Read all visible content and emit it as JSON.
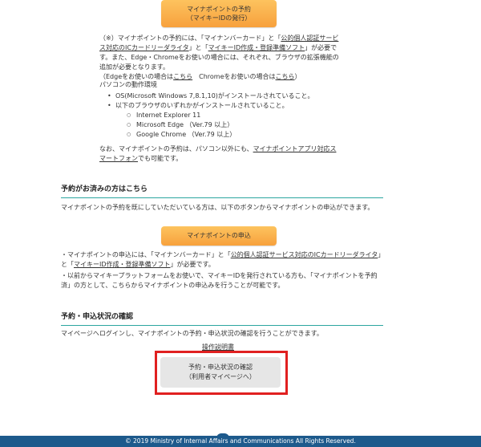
{
  "reserve_button": {
    "line1": "マイナポイントの予約",
    "line2": "（マイキーIDの発行）"
  },
  "requirements": {
    "t1": "（※）マイナポイントの予約には、「マイナンバーカード」と「",
    "link1": "公的個人認証サービス対応のICカードリーダライタ",
    "t2": "」と「",
    "link2": "マイキーID作成・登録準備ソフト",
    "t3": "」が必要です。また、Edge・Chromeをお使いの場合には、それぞれ、ブラウザの拡張機能の追加が必要となります。",
    "edge_prefix": "（Edgeをお使いの場合は",
    "edge_link": "こちら",
    "chrome_prefix": "　Chromeをお使いの場合は",
    "chrome_link": "こちら",
    "close": "）"
  },
  "pc_env": {
    "title": "パソコンの動作環境",
    "os": "OS(Microsoft Windows 7,8.1,10)がインストールされていること。",
    "browsers_intro": "以下のブラウザのいずれかがインストールされていること。",
    "browsers": [
      "Internet Explorer 11",
      "Microsoft Edge （Ver.79 以上）",
      "Google Chrome （Ver.79 以上）"
    ]
  },
  "smartphone_note": {
    "t1": "なお、マイナポイントの予約は、パソコン以外にも、",
    "link": "マイナポイントアプリ対応スマートフォン",
    "t2": "でも可能です。"
  },
  "reserved_section": {
    "heading": "予約がお済みの方はこちら",
    "desc": "マイナポイントの予約を既にしていただいている方は、以下のボタンからマイナポイントの申込ができます。",
    "apply_button": "マイナポイントの申込",
    "note1_a": "・マイナポイントの申込には、「マイナンバーカード」と「",
    "note1_link1": "公的個人認証サービス対応のICカードリーダライタ",
    "note1_b": "」と「",
    "note1_link2": "マイキーID作成・登録準備ソフト",
    "note1_c": "」が必要です。",
    "note2": "・以前からマイキープラットフォームをお使いで、マイキーIDを発行されている方も、「マイナポイントを予約済」の方として、こちらからマイナポイントの申込みを行うことが可能です。"
  },
  "status_section": {
    "heading": "予約・申込状況の確認",
    "desc": "マイページへログインし、マイナポイントの予約・申込状況の確認を行うことができます。",
    "manual_link": "操作説明書",
    "button_line1": "予約・申込状況の確認",
    "button_line2": "（利用者マイページへ）"
  },
  "footer": {
    "copyright": "© 2019 Ministry of Internal Affairs and Communications All Rights Reserved."
  },
  "colors": {
    "accent_orange": "#f7a13d",
    "section_rule": "#2ca6a0",
    "highlight_frame": "#e02020",
    "footer_bg": "#1d5a8c"
  }
}
